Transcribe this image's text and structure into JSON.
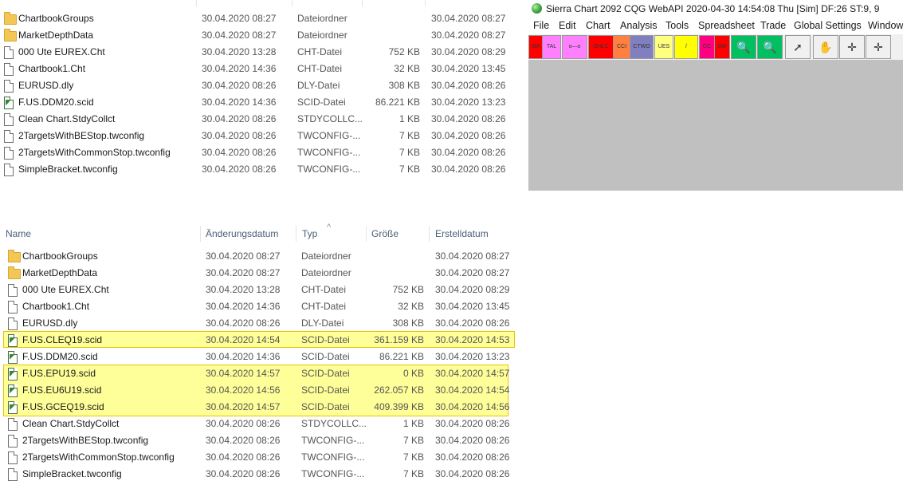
{
  "top_explorer": {
    "header_fragments": {
      "date_header_partial": "",
      "type_header_partial": "yp"
    },
    "rows": [
      {
        "name": "ChartbookGroups",
        "date": "30.04.2020 08:27",
        "type": "Dateiordner",
        "size": "",
        "created": "30.04.2020 08:27",
        "icon": "folder-icon"
      },
      {
        "name": "MarketDepthData",
        "date": "30.04.2020 08:27",
        "type": "Dateiordner",
        "size": "",
        "created": "30.04.2020 08:27",
        "icon": "folder-icon"
      },
      {
        "name": "000 Ute EUREX.Cht",
        "date": "30.04.2020 13:28",
        "type": "CHT-Datei",
        "size": "752 KB",
        "created": "30.04.2020 08:29",
        "icon": "file-icon"
      },
      {
        "name": "Chartbook1.Cht",
        "date": "30.04.2020 14:36",
        "type": "CHT-Datei",
        "size": "32 KB",
        "created": "30.04.2020 13:45",
        "icon": "file-icon"
      },
      {
        "name": "EURUSD.dly",
        "date": "30.04.2020 08:26",
        "type": "DLY-Datei",
        "size": "308 KB",
        "created": "30.04.2020 08:26",
        "icon": "file-icon"
      },
      {
        "name": "F.US.DDM20.scid",
        "date": "30.04.2020 14:36",
        "type": "SCID-Datei",
        "size": "86.221 KB",
        "created": "30.04.2020 13:23",
        "icon": "scid-icon"
      },
      {
        "name": "Clean Chart.StdyCollct",
        "date": "30.04.2020 08:26",
        "type": "STDYCOLLC...",
        "size": "1 KB",
        "created": "30.04.2020 08:26",
        "icon": "file-icon"
      },
      {
        "name": "2TargetsWithBEStop.twconfig",
        "date": "30.04.2020 08:26",
        "type": "TWCONFIG-...",
        "size": "7 KB",
        "created": "30.04.2020 08:26",
        "icon": "file-icon"
      },
      {
        "name": "2TargetsWithCommonStop.twconfig",
        "date": "30.04.2020 08:26",
        "type": "TWCONFIG-...",
        "size": "7 KB",
        "created": "30.04.2020 08:26",
        "icon": "file-icon"
      },
      {
        "name": "SimpleBracket.twconfig",
        "date": "30.04.2020 08:26",
        "type": "TWCONFIG-...",
        "size": "7 KB",
        "created": "30.04.2020 08:26",
        "icon": "file-icon"
      }
    ]
  },
  "bottom_explorer": {
    "headers": {
      "name": "Name",
      "date": "Änderungsdatum",
      "type": "Typ",
      "size": "Größe",
      "created": "Erstelldatum",
      "sort_arrow": "^"
    },
    "rows": [
      {
        "name": "ChartbookGroups",
        "date": "30.04.2020 08:27",
        "type": "Dateiordner",
        "size": "",
        "created": "30.04.2020 08:27",
        "icon": "folder-icon",
        "highlight": false
      },
      {
        "name": "MarketDepthData",
        "date": "30.04.2020 08:27",
        "type": "Dateiordner",
        "size": "",
        "created": "30.04.2020 08:27",
        "icon": "folder-icon",
        "highlight": false
      },
      {
        "name": "000 Ute EUREX.Cht",
        "date": "30.04.2020 13:28",
        "type": "CHT-Datei",
        "size": "752 KB",
        "created": "30.04.2020 08:29",
        "icon": "file-icon",
        "highlight": false
      },
      {
        "name": "Chartbook1.Cht",
        "date": "30.04.2020 14:36",
        "type": "CHT-Datei",
        "size": "32 KB",
        "created": "30.04.2020 13:45",
        "icon": "file-icon",
        "highlight": false
      },
      {
        "name": "EURUSD.dly",
        "date": "30.04.2020 08:26",
        "type": "DLY-Datei",
        "size": "308 KB",
        "created": "30.04.2020 08:26",
        "icon": "file-icon",
        "highlight": false
      },
      {
        "name": "F.US.CLEQ19.scid",
        "date": "30.04.2020 14:54",
        "type": "SCID-Datei",
        "size": "361.159 KB",
        "created": "30.04.2020 14:53",
        "icon": "scid-icon",
        "highlight": true
      },
      {
        "name": "F.US.DDM20.scid",
        "date": "30.04.2020 14:36",
        "type": "SCID-Datei",
        "size": "86.221 KB",
        "created": "30.04.2020 13:23",
        "icon": "scid-icon",
        "highlight": false
      },
      {
        "name": "F.US.EPU19.scid",
        "date": "30.04.2020 14:57",
        "type": "SCID-Datei",
        "size": "0 KB",
        "created": "30.04.2020 14:57",
        "icon": "scid-icon",
        "highlight": true
      },
      {
        "name": "F.US.EU6U19.scid",
        "date": "30.04.2020 14:56",
        "type": "SCID-Datei",
        "size": "262.057 KB",
        "created": "30.04.2020 14:54",
        "icon": "scid-icon",
        "highlight": true
      },
      {
        "name": "F.US.GCEQ19.scid",
        "date": "30.04.2020 14:57",
        "type": "SCID-Datei",
        "size": "409.399 KB",
        "created": "30.04.2020 14:56",
        "icon": "scid-icon",
        "highlight": true
      },
      {
        "name": "Clean Chart.StdyCollct",
        "date": "30.04.2020 08:26",
        "type": "STDYCOLLC...",
        "size": "1 KB",
        "created": "30.04.2020 08:26",
        "icon": "file-icon",
        "highlight": false
      },
      {
        "name": "2TargetsWithBEStop.twconfig",
        "date": "30.04.2020 08:26",
        "type": "TWCONFIG-...",
        "size": "7 KB",
        "created": "30.04.2020 08:26",
        "icon": "file-icon",
        "highlight": false
      },
      {
        "name": "2TargetsWithCommonStop.twconfig",
        "date": "30.04.2020 08:26",
        "type": "TWCONFIG-...",
        "size": "7 KB",
        "created": "30.04.2020 08:26",
        "icon": "file-icon",
        "highlight": false
      },
      {
        "name": "SimpleBracket.twconfig",
        "date": "30.04.2020 08:26",
        "type": "TWCONFIG-...",
        "size": "7 KB",
        "created": "30.04.2020 08:26",
        "icon": "file-icon",
        "highlight": false
      }
    ]
  },
  "sierra_chart": {
    "title": "Sierra Chart 2092 CQG WebAPI 2020-04-30  14:54:08 Thu [Sim]  DF:26  ST:9, 9",
    "menu": [
      "File",
      "Edit",
      "Chart",
      "Analysis",
      "Tools",
      "Spreadsheet",
      "Trade",
      "Global Settings",
      "Window"
    ],
    "toolbar": [
      {
        "label": "ISA",
        "color": "#ff0000"
      },
      {
        "label": "TAL",
        "color": "#ff80ff"
      },
      {
        "label": "o—o",
        "color": "#ff80ff"
      },
      {
        "label": "OHLC",
        "color": "#ff0000"
      },
      {
        "label": "CCI",
        "color": "#ff8040"
      },
      {
        "label": "CTWO",
        "color": "#8080c0"
      },
      {
        "label": "UES",
        "color": "#ffff80"
      },
      {
        "label": "/",
        "color": "#ffff00"
      },
      {
        "label": "CC",
        "color": "#ff0080"
      },
      {
        "label": "SW",
        "color": "#ff0000"
      },
      {
        "label": "zoom",
        "color": "#00c060"
      },
      {
        "label": "zoom",
        "color": "#00c060"
      },
      {
        "label": "pointer",
        "color": "#f0f0f0"
      },
      {
        "label": "hand",
        "color": "#f0f0f0"
      },
      {
        "label": "crosshair",
        "color": "#f0f0f0"
      },
      {
        "label": "crosshair-2",
        "color": "#f0f0f0"
      }
    ],
    "colors": {
      "client_area": "#c0c0c0",
      "highlight": "#ffff99",
      "highlight_border": "#e8c400"
    }
  }
}
